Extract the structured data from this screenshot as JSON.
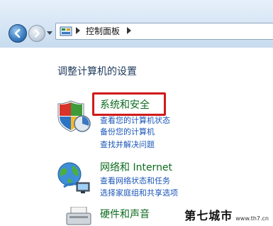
{
  "address_bar": {
    "breadcrumb": "控制面板"
  },
  "page": {
    "title": "调整计算机的设置"
  },
  "categories": [
    {
      "title": "系统和安全",
      "links": [
        "查看您的计算机状态",
        "备份您的计算机",
        "查找并解决问题"
      ]
    },
    {
      "title": "网络和 Internet",
      "links": [
        "查看网络状态和任务",
        "选择家庭组和共享选项"
      ]
    },
    {
      "title": "硬件和声音",
      "links": []
    }
  ],
  "watermark": {
    "name": "第七城市",
    "url": "www.th7.cn"
  },
  "colors": {
    "category_title": "#0d6b1e",
    "link": "#1a56b8",
    "highlight": "#d11a1a",
    "page_title": "#1e395b"
  }
}
